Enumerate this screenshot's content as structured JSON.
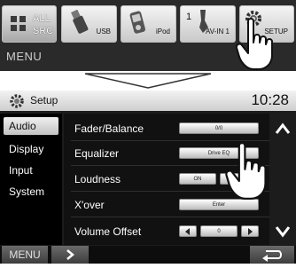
{
  "source_bar": {
    "all_src_line1": "ALL",
    "all_src_line2": "SRC",
    "usb": "USB",
    "ipod": "iPod",
    "avin": "AV-IN 1",
    "avin_number": "1",
    "setup": "SETUP",
    "menu": "MENU"
  },
  "setup": {
    "title": "Setup",
    "time": "10:28",
    "sidebar": [
      {
        "label": "Audio",
        "active": true
      },
      {
        "label": "Display",
        "active": false
      },
      {
        "label": "Input",
        "active": false
      },
      {
        "label": "System",
        "active": false
      }
    ],
    "rows": [
      {
        "label": "Fader/Balance",
        "value": "0/0"
      },
      {
        "label": "Equalizer",
        "value": "Drive EQ"
      },
      {
        "label": "Loudness",
        "value": "ON"
      },
      {
        "label": "X'over",
        "value": "Enter"
      },
      {
        "label": "Volume Offset",
        "value": "0"
      }
    ],
    "footer_menu": "MENU"
  },
  "colors": {
    "screen_bg": "#1c1c1c",
    "header_bg": "#e6e6e6",
    "active_tab": "#dcdcdc"
  },
  "icons": [
    "grid-icon",
    "usb-icon",
    "ipod-icon",
    "av-in-icon",
    "gear-icon",
    "hand-pointer-icon",
    "chevron-up-icon",
    "chevron-down-icon",
    "arrow-left-icon",
    "arrow-right-icon",
    "back-return-icon"
  ]
}
